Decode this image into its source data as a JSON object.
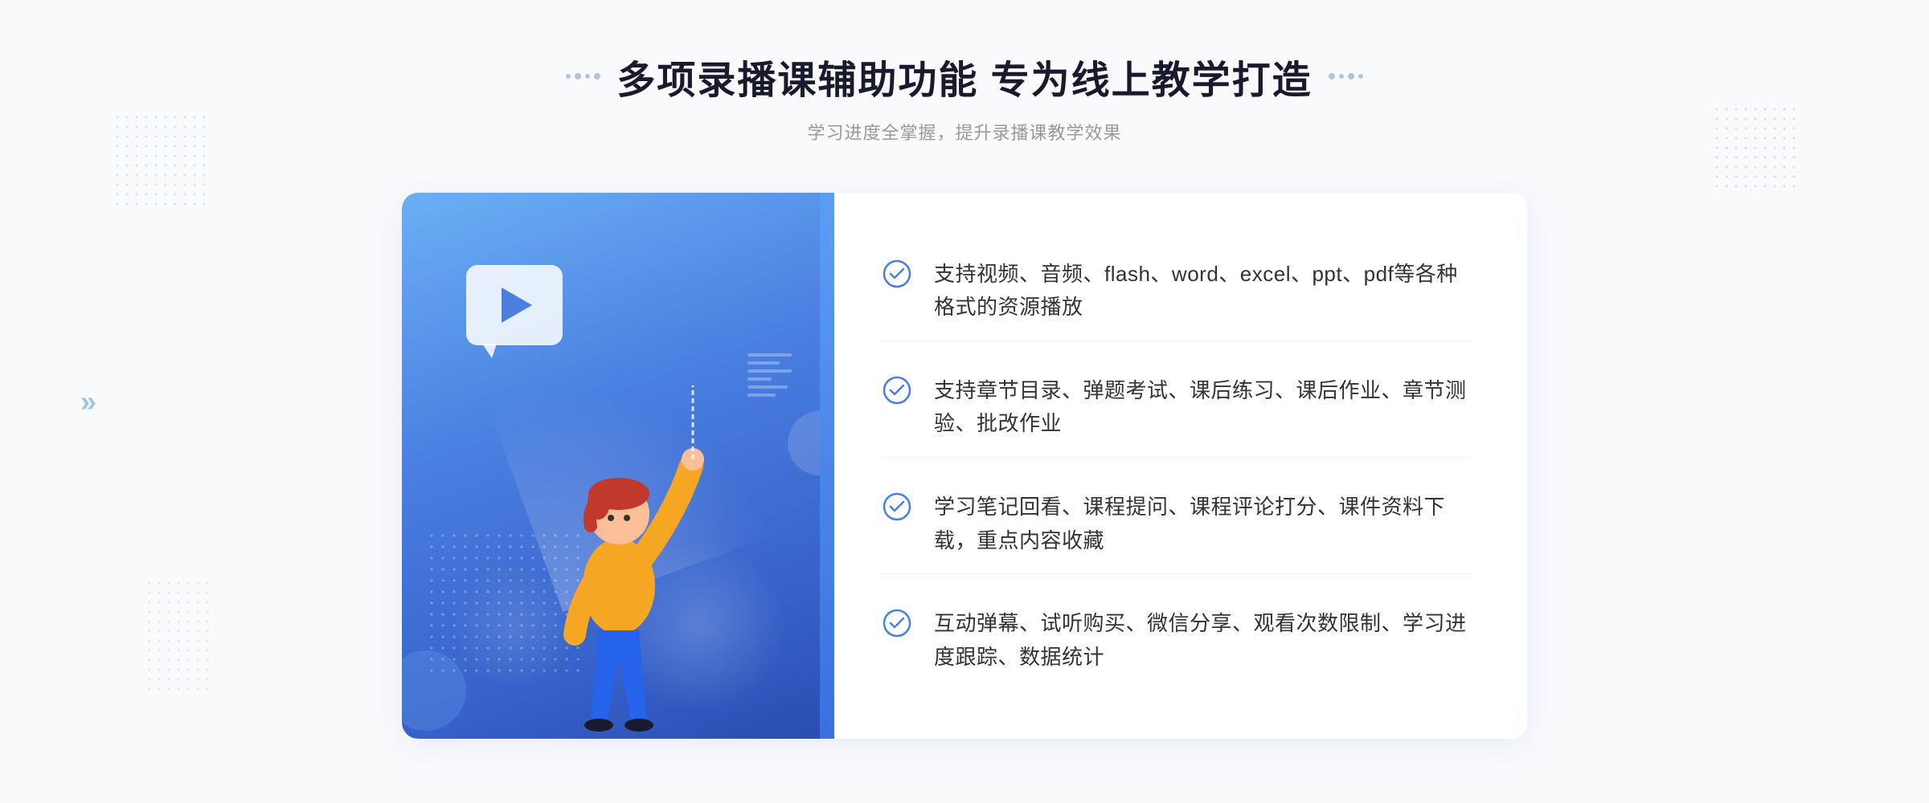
{
  "page": {
    "background": "#f9fafc"
  },
  "header": {
    "title": "多项录播课辅助功能 专为线上教学打造",
    "subtitle": "学习进度全掌握，提升录播课教学效果",
    "title_dots_left": "decorative dots",
    "title_dots_right": "decorative dots"
  },
  "features": [
    {
      "id": 1,
      "text": "支持视频、音频、flash、word、excel、ppt、pdf等各种格式的资源播放"
    },
    {
      "id": 2,
      "text": "支持章节目录、弹题考试、课后练习、课后作业、章节测验、批改作业"
    },
    {
      "id": 3,
      "text": "学习笔记回看、课程提问、课程评论打分、课件资料下载，重点内容收藏"
    },
    {
      "id": 4,
      "text": "互动弹幕、试听购买、微信分享、观看次数限制、学习进度跟踪、数据统计"
    }
  ],
  "icons": {
    "check": "check-circle",
    "play": "play-triangle",
    "arrow_left": "»"
  },
  "colors": {
    "blue_gradient_start": "#6ab0f5",
    "blue_gradient_end": "#3560c8",
    "check_color": "#4a7fe0",
    "text_dark": "#333333",
    "text_light": "#999999",
    "title_color": "#1a1a2e"
  }
}
